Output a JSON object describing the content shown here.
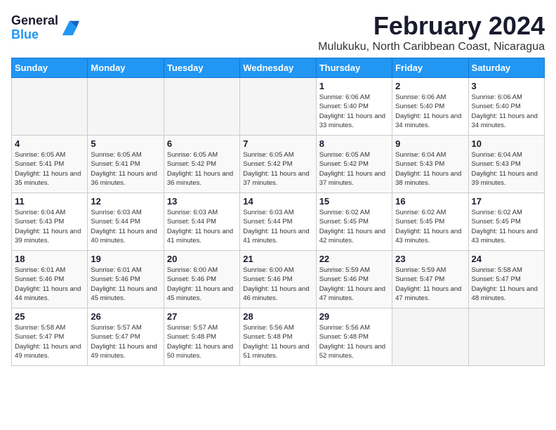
{
  "app": {
    "name": "General",
    "name_blue": "Blue"
  },
  "header": {
    "month": "February 2024",
    "location": "Mulukuku, North Caribbean Coast, Nicaragua"
  },
  "weekdays": [
    "Sunday",
    "Monday",
    "Tuesday",
    "Wednesday",
    "Thursday",
    "Friday",
    "Saturday"
  ],
  "weeks": [
    [
      {
        "day": "",
        "sunrise": "",
        "sunset": "",
        "daylight": ""
      },
      {
        "day": "",
        "sunrise": "",
        "sunset": "",
        "daylight": ""
      },
      {
        "day": "",
        "sunrise": "",
        "sunset": "",
        "daylight": ""
      },
      {
        "day": "",
        "sunrise": "",
        "sunset": "",
        "daylight": ""
      },
      {
        "day": "1",
        "sunrise": "Sunrise: 6:06 AM",
        "sunset": "Sunset: 5:40 PM",
        "daylight": "Daylight: 11 hours and 33 minutes."
      },
      {
        "day": "2",
        "sunrise": "Sunrise: 6:06 AM",
        "sunset": "Sunset: 5:40 PM",
        "daylight": "Daylight: 11 hours and 34 minutes."
      },
      {
        "day": "3",
        "sunrise": "Sunrise: 6:06 AM",
        "sunset": "Sunset: 5:40 PM",
        "daylight": "Daylight: 11 hours and 34 minutes."
      }
    ],
    [
      {
        "day": "4",
        "sunrise": "Sunrise: 6:05 AM",
        "sunset": "Sunset: 5:41 PM",
        "daylight": "Daylight: 11 hours and 35 minutes."
      },
      {
        "day": "5",
        "sunrise": "Sunrise: 6:05 AM",
        "sunset": "Sunset: 5:41 PM",
        "daylight": "Daylight: 11 hours and 36 minutes."
      },
      {
        "day": "6",
        "sunrise": "Sunrise: 6:05 AM",
        "sunset": "Sunset: 5:42 PM",
        "daylight": "Daylight: 11 hours and 36 minutes."
      },
      {
        "day": "7",
        "sunrise": "Sunrise: 6:05 AM",
        "sunset": "Sunset: 5:42 PM",
        "daylight": "Daylight: 11 hours and 37 minutes."
      },
      {
        "day": "8",
        "sunrise": "Sunrise: 6:05 AM",
        "sunset": "Sunset: 5:42 PM",
        "daylight": "Daylight: 11 hours and 37 minutes."
      },
      {
        "day": "9",
        "sunrise": "Sunrise: 6:04 AM",
        "sunset": "Sunset: 5:43 PM",
        "daylight": "Daylight: 11 hours and 38 minutes."
      },
      {
        "day": "10",
        "sunrise": "Sunrise: 6:04 AM",
        "sunset": "Sunset: 5:43 PM",
        "daylight": "Daylight: 11 hours and 39 minutes."
      }
    ],
    [
      {
        "day": "11",
        "sunrise": "Sunrise: 6:04 AM",
        "sunset": "Sunset: 5:43 PM",
        "daylight": "Daylight: 11 hours and 39 minutes."
      },
      {
        "day": "12",
        "sunrise": "Sunrise: 6:03 AM",
        "sunset": "Sunset: 5:44 PM",
        "daylight": "Daylight: 11 hours and 40 minutes."
      },
      {
        "day": "13",
        "sunrise": "Sunrise: 6:03 AM",
        "sunset": "Sunset: 5:44 PM",
        "daylight": "Daylight: 11 hours and 41 minutes."
      },
      {
        "day": "14",
        "sunrise": "Sunrise: 6:03 AM",
        "sunset": "Sunset: 5:44 PM",
        "daylight": "Daylight: 11 hours and 41 minutes."
      },
      {
        "day": "15",
        "sunrise": "Sunrise: 6:02 AM",
        "sunset": "Sunset: 5:45 PM",
        "daylight": "Daylight: 11 hours and 42 minutes."
      },
      {
        "day": "16",
        "sunrise": "Sunrise: 6:02 AM",
        "sunset": "Sunset: 5:45 PM",
        "daylight": "Daylight: 11 hours and 43 minutes."
      },
      {
        "day": "17",
        "sunrise": "Sunrise: 6:02 AM",
        "sunset": "Sunset: 5:45 PM",
        "daylight": "Daylight: 11 hours and 43 minutes."
      }
    ],
    [
      {
        "day": "18",
        "sunrise": "Sunrise: 6:01 AM",
        "sunset": "Sunset: 5:46 PM",
        "daylight": "Daylight: 11 hours and 44 minutes."
      },
      {
        "day": "19",
        "sunrise": "Sunrise: 6:01 AM",
        "sunset": "Sunset: 5:46 PM",
        "daylight": "Daylight: 11 hours and 45 minutes."
      },
      {
        "day": "20",
        "sunrise": "Sunrise: 6:00 AM",
        "sunset": "Sunset: 5:46 PM",
        "daylight": "Daylight: 11 hours and 45 minutes."
      },
      {
        "day": "21",
        "sunrise": "Sunrise: 6:00 AM",
        "sunset": "Sunset: 5:46 PM",
        "daylight": "Daylight: 11 hours and 46 minutes."
      },
      {
        "day": "22",
        "sunrise": "Sunrise: 5:59 AM",
        "sunset": "Sunset: 5:46 PM",
        "daylight": "Daylight: 11 hours and 47 minutes."
      },
      {
        "day": "23",
        "sunrise": "Sunrise: 5:59 AM",
        "sunset": "Sunset: 5:47 PM",
        "daylight": "Daylight: 11 hours and 47 minutes."
      },
      {
        "day": "24",
        "sunrise": "Sunrise: 5:58 AM",
        "sunset": "Sunset: 5:47 PM",
        "daylight": "Daylight: 11 hours and 48 minutes."
      }
    ],
    [
      {
        "day": "25",
        "sunrise": "Sunrise: 5:58 AM",
        "sunset": "Sunset: 5:47 PM",
        "daylight": "Daylight: 11 hours and 49 minutes."
      },
      {
        "day": "26",
        "sunrise": "Sunrise: 5:57 AM",
        "sunset": "Sunset: 5:47 PM",
        "daylight": "Daylight: 11 hours and 49 minutes."
      },
      {
        "day": "27",
        "sunrise": "Sunrise: 5:57 AM",
        "sunset": "Sunset: 5:48 PM",
        "daylight": "Daylight: 11 hours and 50 minutes."
      },
      {
        "day": "28",
        "sunrise": "Sunrise: 5:56 AM",
        "sunset": "Sunset: 5:48 PM",
        "daylight": "Daylight: 11 hours and 51 minutes."
      },
      {
        "day": "29",
        "sunrise": "Sunrise: 5:56 AM",
        "sunset": "Sunset: 5:48 PM",
        "daylight": "Daylight: 11 hours and 52 minutes."
      },
      {
        "day": "",
        "sunrise": "",
        "sunset": "",
        "daylight": ""
      },
      {
        "day": "",
        "sunrise": "",
        "sunset": "",
        "daylight": ""
      }
    ]
  ]
}
